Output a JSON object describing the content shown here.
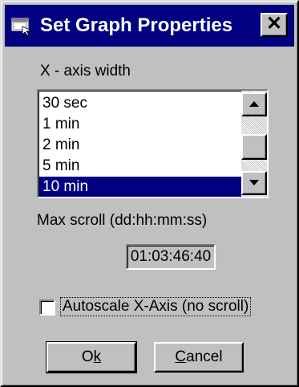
{
  "window": {
    "title": "Set Graph Properties",
    "close_glyph": "✕",
    "icon": "graph-window-icon"
  },
  "xaxis": {
    "label": "X - axis width",
    "options": [
      "30 sec",
      "1 min",
      "2 min",
      "5 min",
      "10 min"
    ],
    "selected_index": 4
  },
  "max_scroll": {
    "label": "Max scroll (dd:hh:mm:ss)",
    "value": "01:03:46:40"
  },
  "autoscale": {
    "label": "Autoscale X-Axis (no scroll)",
    "checked": false
  },
  "buttons": {
    "ok": {
      "before": "O",
      "accel": "k",
      "after": ""
    },
    "cancel": {
      "before": "",
      "accel": "C",
      "after": "ancel"
    }
  },
  "colors": {
    "titlebar": "#000080",
    "face": "#c0c0c0",
    "selection": "#000080"
  }
}
